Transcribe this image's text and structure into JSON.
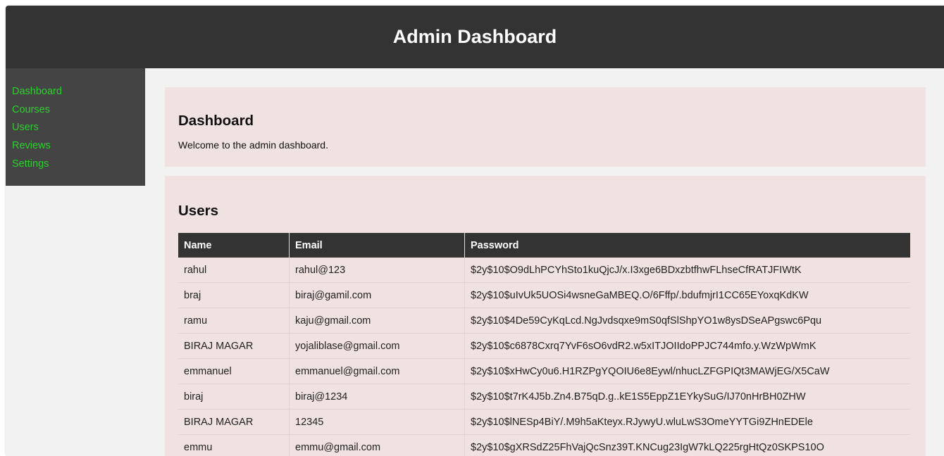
{
  "header": {
    "title": "Admin Dashboard"
  },
  "sidebar": {
    "items": [
      {
        "label": "Dashboard"
      },
      {
        "label": "Courses"
      },
      {
        "label": "Users"
      },
      {
        "label": "Reviews"
      },
      {
        "label": "Settings"
      }
    ],
    "link_color": "#2bd12b"
  },
  "dashboard_card": {
    "title": "Dashboard",
    "text": "Welcome to the admin dashboard."
  },
  "users_card": {
    "title": "Users",
    "columns": [
      "Name",
      "Email",
      "Password"
    ],
    "rows": [
      [
        "rahul",
        "rahul@123",
        "$2y$10$O9dLhPCYhSto1kuQjcJ/x.I3xge6BDxzbtfhwFLhseCfRATJFIWtK"
      ],
      [
        "braj",
        "biraj@gamil.com",
        "$2y$10$uIvUk5UOSi4wsneGaMBEQ.O/6Fffp/.bdufmjrI1CC65EYoxqKdKW"
      ],
      [
        "ramu",
        "kaju@gmail.com",
        "$2y$10$4De59CyKqLcd.NgJvdsqxe9mS0qfSlShpYO1w8ysDSeAPgswc6Pqu"
      ],
      [
        "BIRAJ MAGAR",
        "yojaliblase@gmail.com",
        "$2y$10$c6878Cxrq7YvF6sO6vdR2.w5xITJOIIdoPPJC744mfo.y.WzWpWmK"
      ],
      [
        "emmanuel",
        "emmanuel@gmail.com",
        "$2y$10$xHwCy0u6.H1RZPgYQOIU6e8Eywl/nhucLZFGPIQt3MAWjEG/X5CaW"
      ],
      [
        "biraj",
        "biraj@1234",
        "$2y$10$t7rK4J5b.Zn4.B75qD.g..kE1S5EppZ1EYkySuG/IJ70nHrBH0ZHW"
      ],
      [
        "BIRAJ MAGAR",
        "12345",
        "$2y$10$lNESp4BiY/.M9h5aKteyx.RJywyU.wluLwS3OmeYYTGi9ZHnEDEle"
      ],
      [
        "emmu",
        "emmu@gmail.com",
        "$2y$10$gXRSdZ25FhVajQcSnz39T.KNCug23IgW7kLQ225rgHtQz0SKPS10O"
      ]
    ]
  }
}
